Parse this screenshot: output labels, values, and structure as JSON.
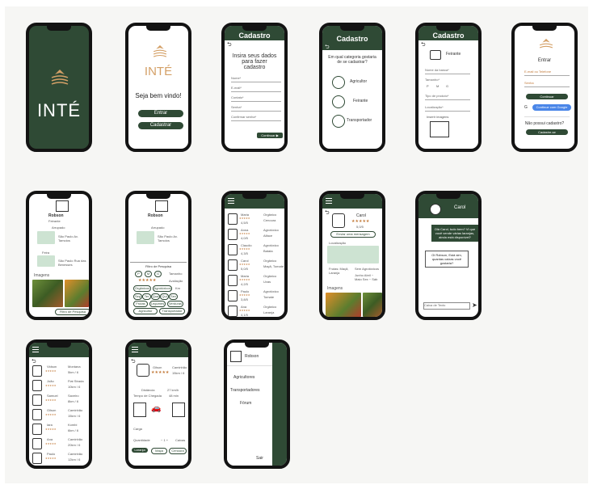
{
  "brand": {
    "name": "INTÉ",
    "primary": "#2f4a35",
    "accent": "#c27a3a"
  },
  "welcome": {
    "greeting": "Seja bem vindo!",
    "enter": "Entrar",
    "register": "Cadastrar"
  },
  "signup": {
    "title": "Cadastro",
    "heading": "Insira seus dados para fazer cadastro",
    "fields": [
      "Nome*",
      "E-mail*",
      "Contato*",
      "Senha*",
      "Confirmar senha*"
    ],
    "continue": "Continuar ▶"
  },
  "category": {
    "title": "Cadastro",
    "question": "Em qual categoria gostaria de se cadastrar?",
    "options": [
      {
        "label": "Agricultor",
        "icon": "farmer-icon"
      },
      {
        "label": "Feirante",
        "icon": "stall-icon"
      },
      {
        "label": "Transportador",
        "icon": "truck-icon"
      }
    ]
  },
  "feirante_form": {
    "title": "Cadastro",
    "role": "Feirante",
    "fields": [
      "Nome da banca*",
      "Tamanho*",
      "Tipo de produto*",
      "Localização*"
    ],
    "sizes": [
      "P",
      "M",
      "G"
    ],
    "image_label": "Inserir imagens"
  },
  "login": {
    "title": "Entrar",
    "user": "E-mail ou Telefone",
    "password": "Senha",
    "continue": "Continuar",
    "google": "Continue com Google",
    "no_account": "Não possui cadastro?",
    "register": "Cadastre-se"
  },
  "profile": {
    "name": "Robson",
    "role": "Feirante",
    "location_label": "Arrupado",
    "address": "São Paulo Av. Tamoios",
    "stand_label": "Feira",
    "stand_address": "São Paulo Rua das Benesses",
    "images_label": "Imagens",
    "filter_button": "Filtro de Pesquisa",
    "filter_title": "Filtro de Pesquisa",
    "filter_sizes": [
      "P",
      "M",
      "G"
    ],
    "filter_size_label": "Tamanho",
    "filter_rating_label": "Avaliação",
    "filter_types": [
      "Orgânicos",
      "Agrotóxicos"
    ],
    "filter_distance_label": "Km",
    "filter_days": [
      "Seg",
      "Ter",
      "Qua",
      "Qui",
      "Sex"
    ],
    "filter_products": [
      "Frutas",
      "Legumes",
      "Verduras"
    ],
    "filter_roles": [
      "Agricultor",
      "Transportador"
    ]
  },
  "farmers_list": [
    {
      "name": "Maria",
      "rating": "4,5/5",
      "distance": "10km",
      "type": "Orgânico",
      "product": "Cenoura"
    },
    {
      "name": "Anna",
      "rating": "4,0/5",
      "distance": "12km",
      "type": "Agrotóxico",
      "product": "Alface"
    },
    {
      "name": "Claudio",
      "rating": "4,3/5",
      "distance": "8km",
      "type": "Agrotóxico",
      "product": "Batata"
    },
    {
      "name": "Carol",
      "rating": "5,0/5",
      "distance": "15km",
      "type": "Orgânico",
      "product": "Maçã, Tomate"
    },
    {
      "name": "Maria",
      "rating": "4,2/5",
      "distance": "20km",
      "type": "Orgânico",
      "product": "Uvas"
    },
    {
      "name": "Paulo",
      "rating": "3,8/5",
      "distance": "18km",
      "type": "Agrotóxico",
      "product": "Tomate"
    },
    {
      "name": "Ana",
      "rating": "4,1/5",
      "distance": "9km",
      "type": "Orgânico",
      "product": "Laranja"
    }
  ],
  "farmer_detail": {
    "name": "Carol",
    "rating_text": "5,0/5",
    "message_button": "Enviar uma mensagem",
    "location_label": "Localização",
    "products_label": "Frutas: Maçã, Laranja",
    "type": "Sem Agrotóxicos",
    "schedule": "Junho Abril ~ Maio Sex ~ Sáb",
    "images_label": "Imagens"
  },
  "chat": {
    "contact": "Carol",
    "msg1": "Olá Carol, tudo bem? Vi que você vende várias laranjas, ainda está disponível?",
    "msg2": "Oi Robson, Está sim, quantas caixas você gostaria?",
    "input_placeholder": "Caixa de Texto"
  },
  "transporters_list": [
    {
      "name": "Vidson",
      "vehicle": "Montana",
      "capacity": "5km / 6"
    },
    {
      "name": "João",
      "vehicle": "Fiat Strada",
      "capacity": "10km / 6"
    },
    {
      "name": "Samuel",
      "vehicle": "Saveiro",
      "capacity": "8km / 6"
    },
    {
      "name": "Gilson",
      "vehicle": "Caminhão",
      "capacity": "15km / 6"
    },
    {
      "name": "Iara",
      "vehicle": "Kombi",
      "capacity": "6km / 6"
    },
    {
      "name": "Ana",
      "vehicle": "Caminhão",
      "capacity": "20km / 6"
    },
    {
      "name": "Paulo",
      "vehicle": "Caminhão",
      "capacity": "12km / 6"
    }
  ],
  "transport_detail": {
    "name": "Gilson",
    "vehicle": "Caminhão",
    "capacity": "15km / 6",
    "distance_label": "Distância",
    "distance_value": "27 km/h",
    "time_label": "Tempo de Chegada",
    "time_value": "48 min",
    "goods_label": "Carga",
    "qty_label": "Quantidade",
    "qty_value": "Caixas",
    "buttons": [
      "Laranja",
      "Maça",
      "Cenoura"
    ]
  },
  "menu": {
    "user": "Robson",
    "items": [
      "Agricultores",
      "Transportadores",
      "Fórum"
    ],
    "exit": "Sair"
  }
}
